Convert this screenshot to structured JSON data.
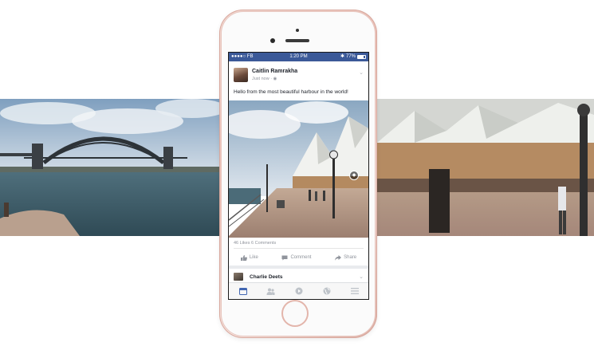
{
  "status_bar": {
    "carrier": "●●●●○ FB",
    "wifi_icon": "wifi-icon",
    "time": "1:20 PM",
    "bluetooth_icon": "bluetooth-icon",
    "battery": "77%"
  },
  "post": {
    "author": "Caitlin Ramrakha",
    "time": "Just now · ",
    "globe_icon": "globe-icon",
    "text": "Hello from the most beautiful harbour in the world!",
    "panorama_badge_icon": "panorama-icon",
    "reactions": "46 Likes  6 Comments",
    "actions": {
      "like": "Like",
      "comment": "Comment",
      "share": "Share"
    }
  },
  "next_post": {
    "author": "Charlie Deets"
  },
  "tabs": [
    {
      "icon": "news-feed-icon",
      "active": true
    },
    {
      "icon": "friends-icon",
      "active": false
    },
    {
      "icon": "video-icon",
      "active": false
    },
    {
      "icon": "globe-icon",
      "active": false
    },
    {
      "icon": "menu-icon",
      "active": false
    }
  ],
  "colors": {
    "facebook_blue": "#3b5998",
    "tab_active": "#4267b2",
    "tab_inactive": "#bec3c9"
  }
}
